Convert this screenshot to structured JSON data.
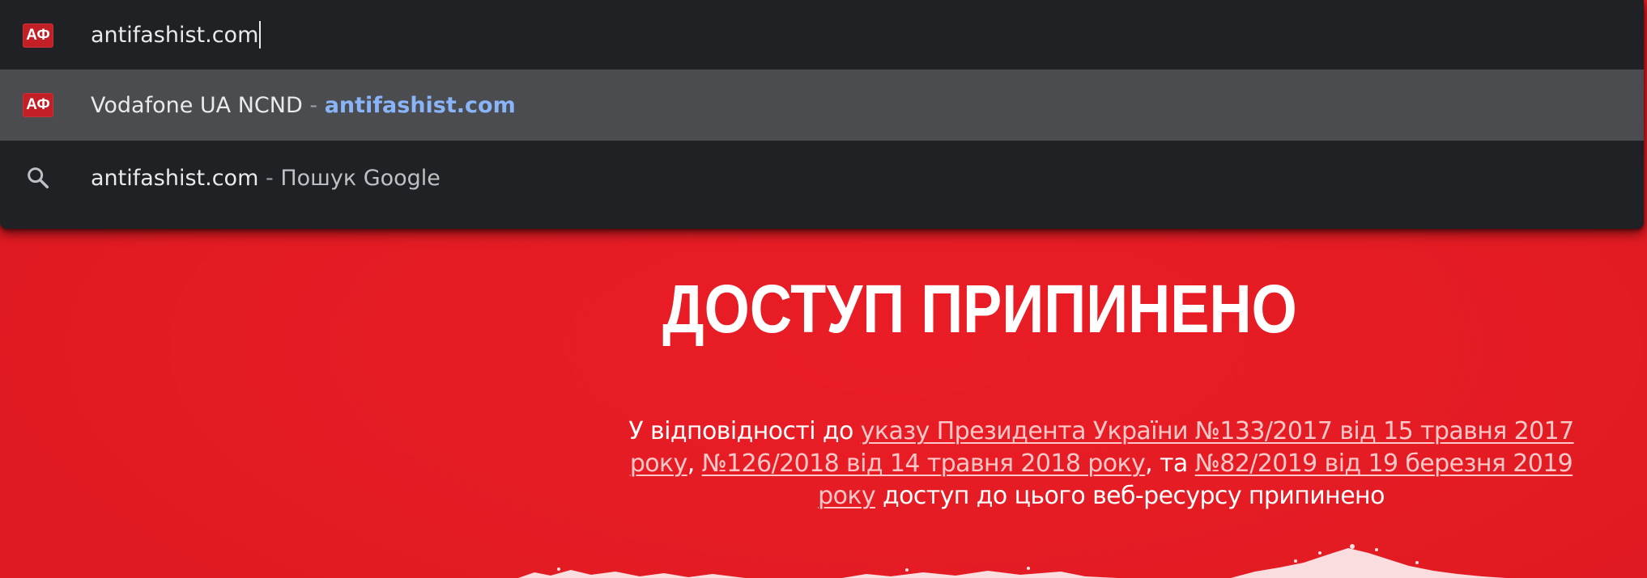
{
  "omnibox": {
    "input_value": "antifashist.com",
    "suggestions": [
      {
        "favicon_text": "АФ",
        "title": "Vodafone UA NCND",
        "separator": " - ",
        "url": "antifashist.com"
      },
      {
        "icon": "search-icon",
        "query": "antifashist.com",
        "separator": " - ",
        "provider": "Пошук Google"
      }
    ],
    "input_favicon_text": "АФ"
  },
  "page": {
    "title": "ДОСТУП ПРИПИНЕНО",
    "text_prefix": "У відповідності до ",
    "link1": "указу Президента України №133/2017 від 15 травня 2017 року",
    "comma": ", ",
    "link2": "№126/2018 від 14 травня 2018 року",
    "and_text": ", та ",
    "link3": "№82/2019 від 19 березня 2019 року",
    "text_suffix": " доступ до цього веб-ресурсу припинено"
  },
  "colors": {
    "page_background": "#e31b23",
    "dropdown_background": "#202124",
    "selected_row": "#4a4c50",
    "url_highlight": "#8ab4f8",
    "link_color": "#ffc7c7"
  }
}
